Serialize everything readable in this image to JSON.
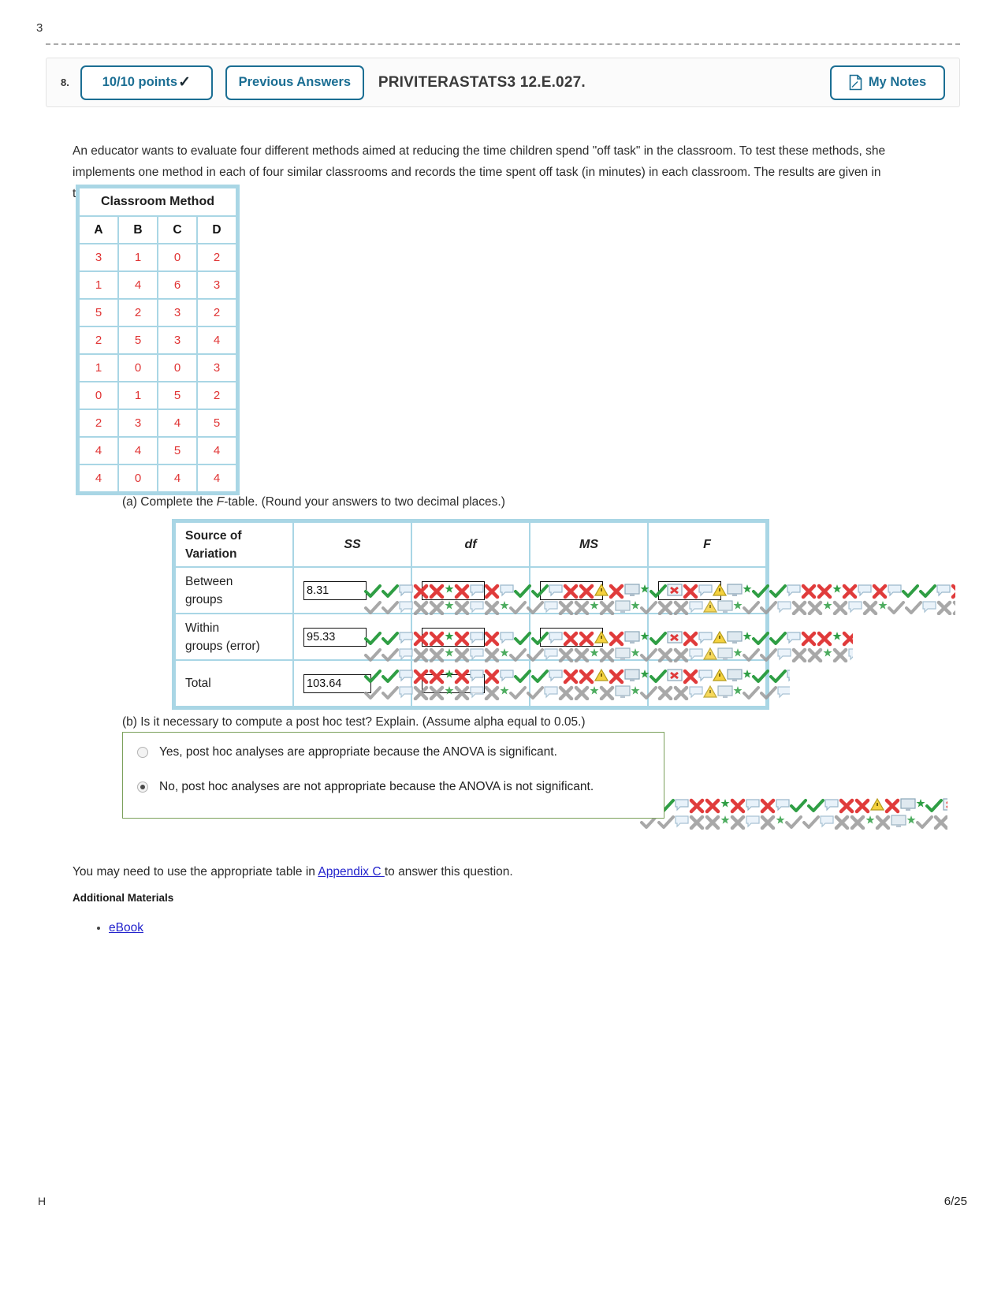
{
  "page": {
    "top_stub": "3",
    "footer_left_stub": "H",
    "footer_page": "6/25"
  },
  "header": {
    "question_number": "8.",
    "points_label": "10/10 points",
    "points_check_icon": "check-icon",
    "previous_answers_label": "Previous Answers",
    "title": "PRIVITERASTATS3 12.E.027.",
    "my_notes_label": "My Notes",
    "notes_icon": "note-page-icon"
  },
  "prompt": {
    "text": "An educator wants to evaluate four different methods aimed at reducing the time children spend \"off task\" in the classroom. To test these methods, she implements one method in each of four similar classrooms and records the time spent off task (in minutes) in each classroom. The results are given in the table."
  },
  "classroom_table": {
    "title": "Classroom Method",
    "columns": [
      "A",
      "B",
      "C",
      "D"
    ],
    "rows": [
      [
        "3",
        "1",
        "0",
        "2"
      ],
      [
        "1",
        "4",
        "6",
        "3"
      ],
      [
        "5",
        "2",
        "3",
        "2"
      ],
      [
        "2",
        "5",
        "3",
        "4"
      ],
      [
        "1",
        "0",
        "0",
        "3"
      ],
      [
        "0",
        "1",
        "5",
        "2"
      ],
      [
        "2",
        "3",
        "4",
        "5"
      ],
      [
        "4",
        "4",
        "5",
        "4"
      ],
      [
        "4",
        "0",
        "4",
        "4"
      ]
    ]
  },
  "part_a": {
    "label_pre": "(a) Complete the ",
    "label_italic": "F",
    "label_post": "-table. (Round your answers to two decimal places.)"
  },
  "f_table": {
    "headers": {
      "source_line1": "Source of",
      "source_line2": "Variation",
      "ss": "SS",
      "df": "df",
      "ms": "MS",
      "f": "F"
    },
    "rows": [
      {
        "label_line1": "Between",
        "label_line2": "groups",
        "ss": "8.31",
        "df": "",
        "ms": "",
        "f": ""
      },
      {
        "label_line1": "Within",
        "label_line2": "groups (error)",
        "ss": "95.33",
        "df": "",
        "ms": "",
        "f": ""
      },
      {
        "label_line1": "Total",
        "label_line2": "",
        "ss": "103.64",
        "df": "",
        "ms": "",
        "f": ""
      }
    ]
  },
  "part_b": {
    "question": "(b) Is it necessary to compute a post hoc test? Explain. (Assume alpha equal to 0.05.)",
    "options": [
      {
        "label": "Yes, post hoc analyses are appropriate because the ANOVA is significant.",
        "selected": false
      },
      {
        "label": "No, post hoc analyses are not appropriate because the ANOVA is not significant.",
        "selected": true
      }
    ]
  },
  "footer_content": {
    "appendix_pre": "You may need to use the appropriate table in ",
    "appendix_link": "Appendix C ",
    "appendix_post": "to answer this question.",
    "additional_materials_label": "Additional Materials",
    "ebook_label": "eBook"
  },
  "colors": {
    "accent_blue": "#1b6e93",
    "table_border": "#a9d6e5",
    "data_red": "#e03434",
    "link_blue": "#2222cc",
    "choice_border": "#7ba05b"
  }
}
